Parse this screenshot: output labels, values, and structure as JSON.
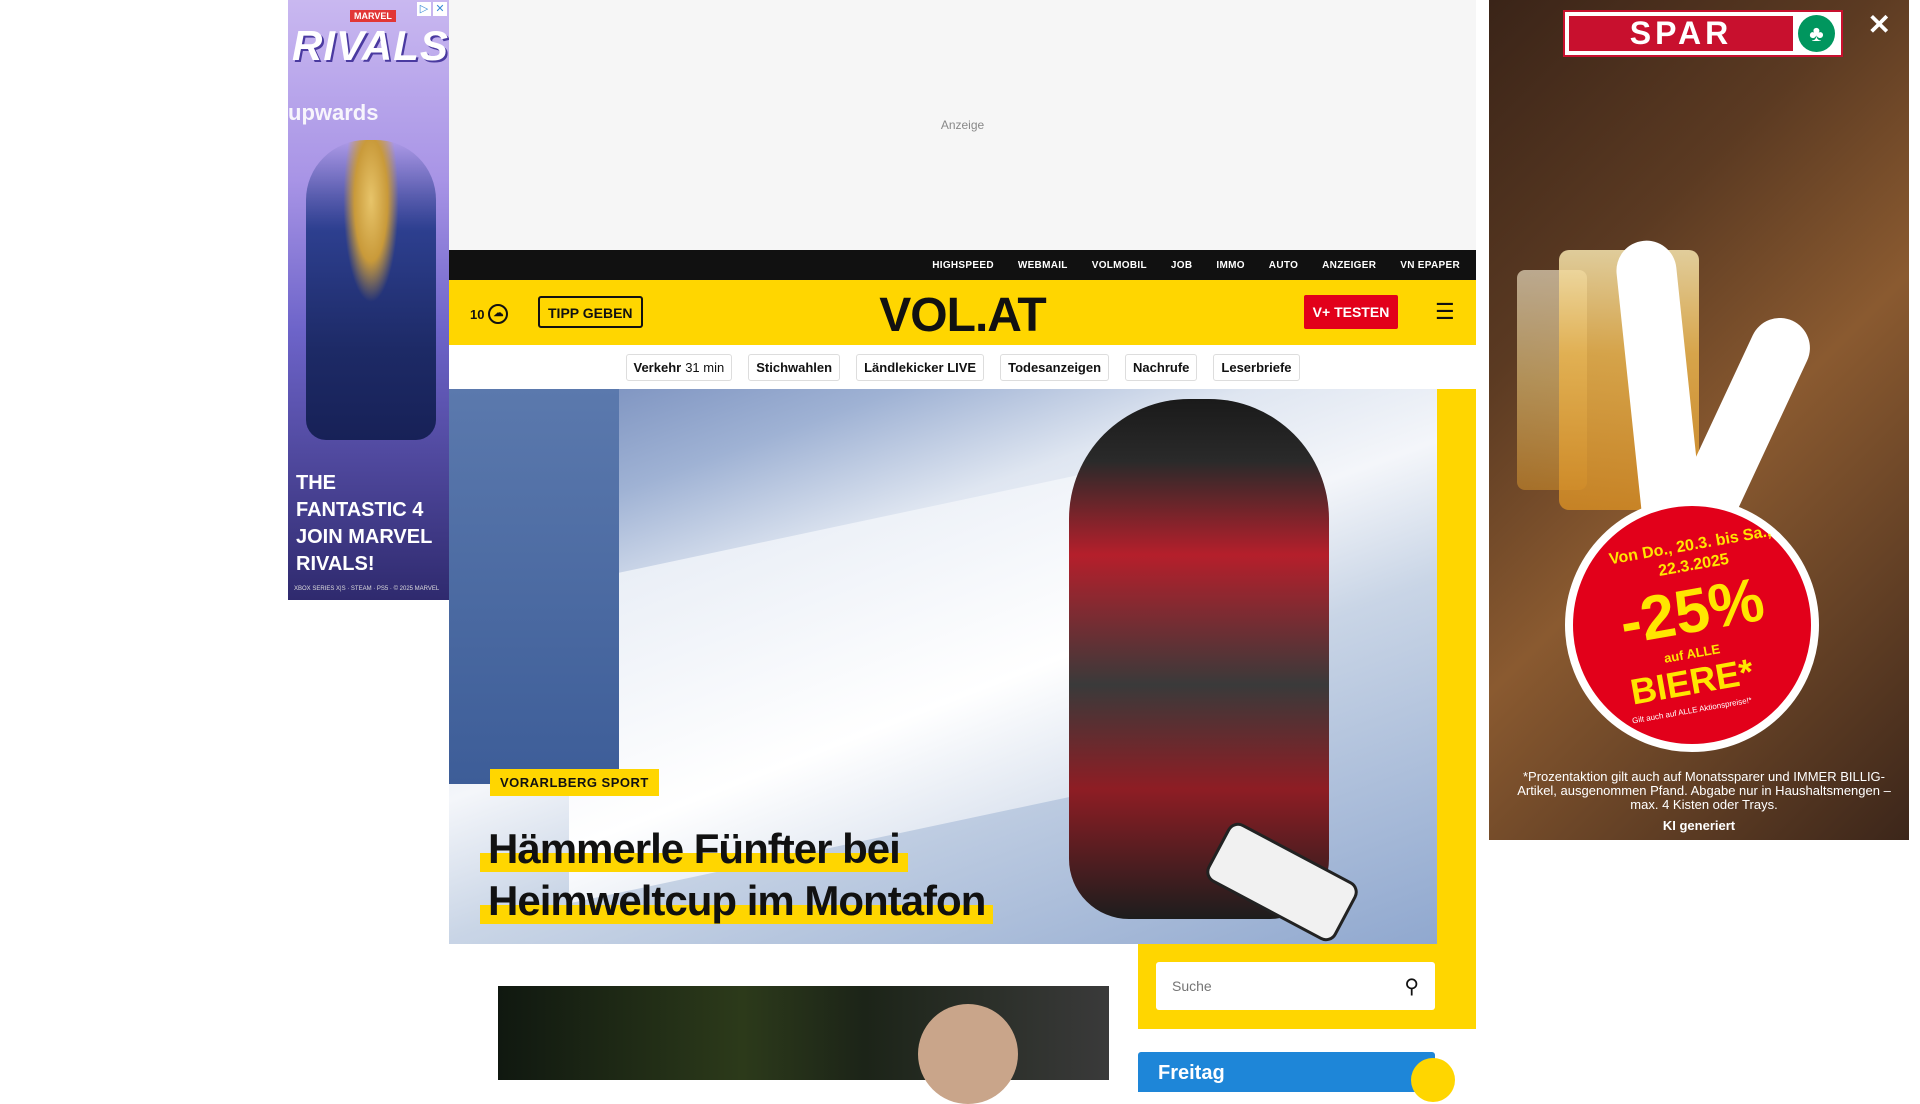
{
  "ads": {
    "top_label": "Anzeige",
    "left": {
      "brand": "MARVEL",
      "title": "RIVALS",
      "upwards": "upwards",
      "tagline": "THE\nFANTASTIC 4\nJOIN MARVEL\nRIVALS!",
      "platforms": "XBOX SERIES X|S · STEAM · PS5 · © 2025 MARVEL",
      "adchoice_play": "▷",
      "adchoice_close": "✕"
    },
    "right": {
      "brand": "SPAR",
      "close": "✕",
      "date": "Von Do., 20.3. bis Sa., 22.3.2025",
      "percent": "-25%",
      "auf": "auf ALLE",
      "product": "BIERE*",
      "small": "Gilt auch auf ALLE Aktionspreise!*",
      "fine_print": "*Prozentaktion gilt auch auf Monatssparer und IMMER BILLIG-Artikel, ausgenommen Pfand. Abgabe nur in Haushaltsmengen – max. 4 Kisten oder Trays.",
      "ki": "KI generiert"
    }
  },
  "topnav": [
    "HIGHSPEED",
    "WEBMAIL",
    "VOLMOBIL",
    "JOB",
    "IMMO",
    "AUTO",
    "ANZEIGER",
    "VN EPAPER"
  ],
  "header": {
    "temperature": "10",
    "tipp_label": "TIPP GEBEN",
    "logo": "VOL.AT",
    "vplus_label": "V+ TESTEN"
  },
  "quicklinks": [
    {
      "label": "Verkehr",
      "sub": "31 min"
    },
    {
      "label": "Stichwahlen",
      "sub": ""
    },
    {
      "label": "Ländlekicker LIVE",
      "sub": ""
    },
    {
      "label": "Todesanzeigen",
      "sub": ""
    },
    {
      "label": "Nachrufe",
      "sub": ""
    },
    {
      "label": "Leserbriefe",
      "sub": ""
    }
  ],
  "hero": {
    "kicker": "VORARLBERG SPORT",
    "headline": "Hämmerle Fünfter bei Heimweltcup im Montafon"
  },
  "search": {
    "placeholder": "Suche"
  },
  "day_card": {
    "title": "Freitag"
  },
  "colors": {
    "brand_yellow": "#ffd600",
    "vplus_red": "#e2001a",
    "topbar": "#111111"
  }
}
